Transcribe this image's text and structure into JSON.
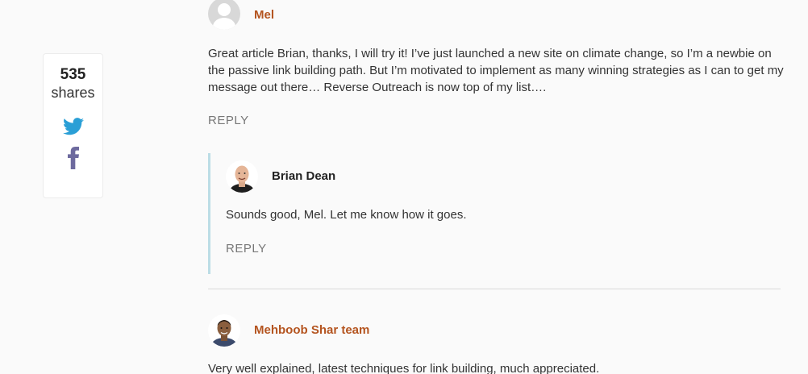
{
  "share": {
    "count": "535",
    "label": "shares",
    "twitter_icon": "twitter-icon",
    "facebook_icon": "facebook-icon",
    "twitter_color": "#2a9fd6",
    "facebook_color": "#6d6a9e"
  },
  "comments": [
    {
      "author": "Mel",
      "text": "Great article Brian, thanks, I will try it! I’ve just launched a new site on climate change, so I’m a newbie on the passive link building path. But I’m motivated to implement as many winning strategies as I can to get my message out there… Reverse Outreach is now top of my list….",
      "reply_label": "REPLY",
      "author_color": "#b4541f"
    },
    {
      "author": "Brian Dean",
      "text": "Sounds good, Mel. Let me know how it goes.",
      "reply_label": "REPLY",
      "author_color": "#222222",
      "thread_bar_color": "#bcdde6"
    },
    {
      "author": "Mehboob Shar team",
      "text": "Very well explained, latest techniques for link building, much appreciated.",
      "author_color": "#b4541f"
    }
  ]
}
